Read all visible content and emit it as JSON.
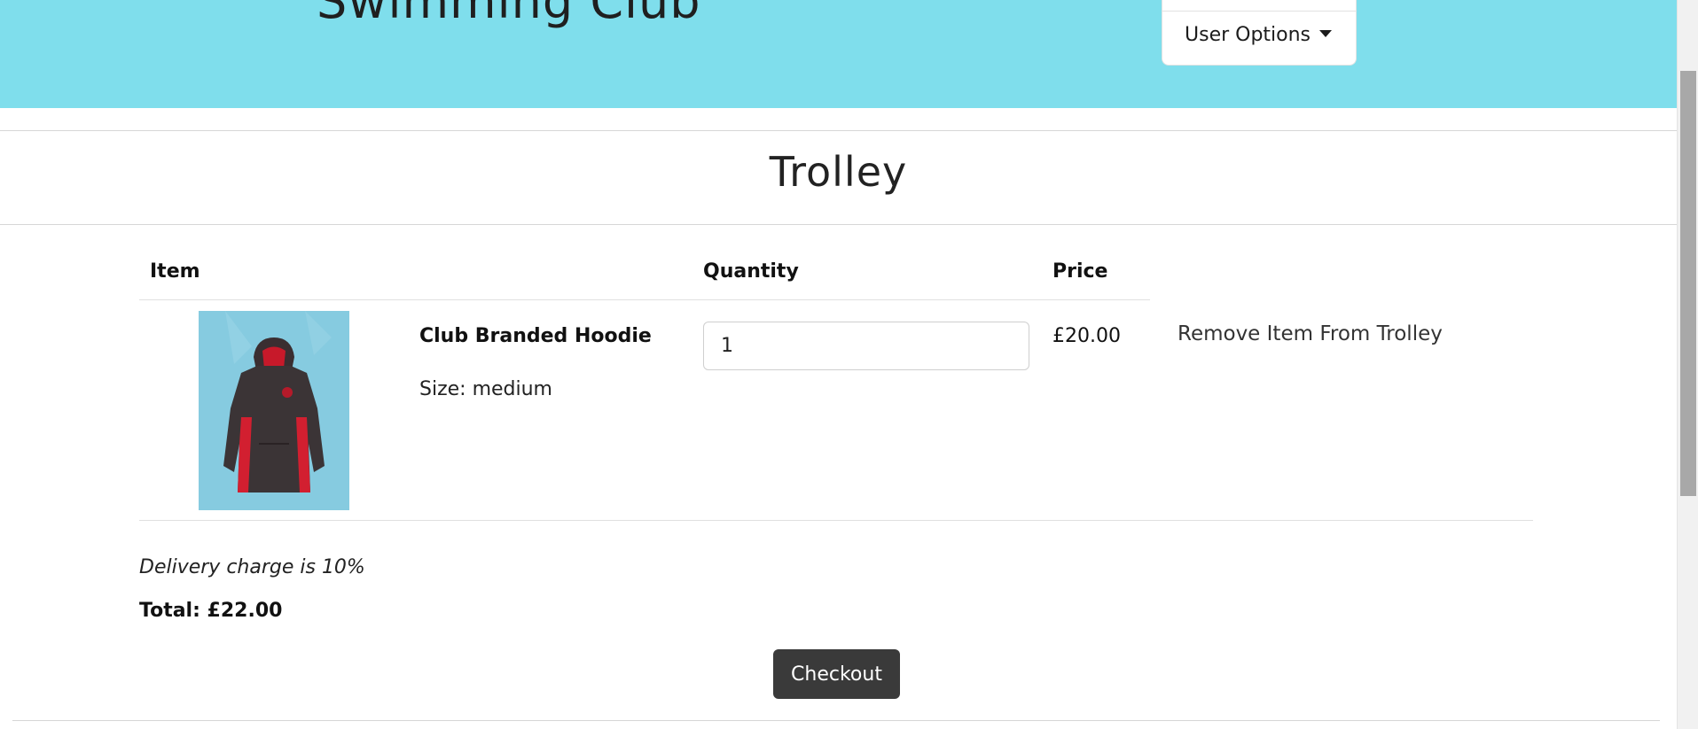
{
  "header": {
    "club_title": "Swimming Club",
    "user_options_label": "User Options"
  },
  "page": {
    "title": "Trolley"
  },
  "table": {
    "columns": [
      "Item",
      "Quantity",
      "Price"
    ],
    "rows": [
      {
        "name": "Club Branded Hoodie",
        "size": "Size: medium",
        "quantity": "1",
        "price": "£20.00",
        "remove_label": "Remove Item From Trolley"
      }
    ]
  },
  "summary": {
    "delivery_note": "Delivery charge is 10%",
    "total": "Total: £22.00"
  },
  "actions": {
    "checkout_label": "Checkout"
  },
  "colors": {
    "banner": "#7fdeec",
    "checkout_button": "#3a3a3a"
  }
}
